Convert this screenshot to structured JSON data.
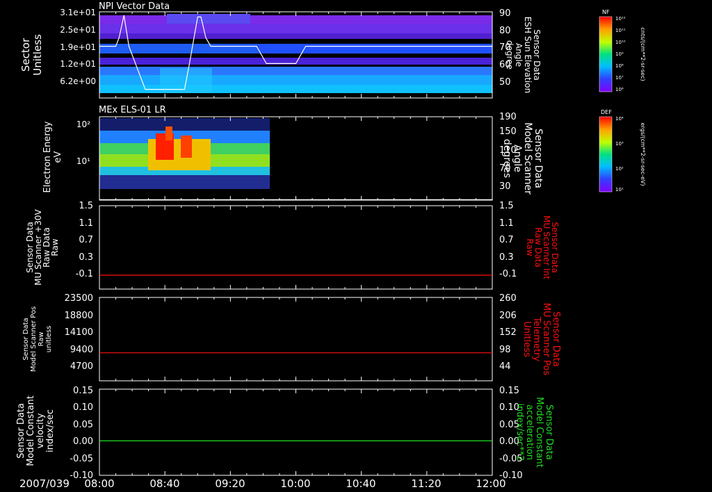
{
  "date_label": "2007/039",
  "x_ticks": [
    "08:00",
    "08:40",
    "09:20",
    "10:00",
    "10:40",
    "11:20",
    "12:00"
  ],
  "colors": {
    "white": "#ffffff",
    "red": "#ff1010",
    "green": "#22dd22",
    "panel_bg": "#000000"
  },
  "chart_data": [
    {
      "type": "heatmap",
      "title": "NPI Vector Data",
      "ylabel": [
        "Sector",
        "Unitless"
      ],
      "y_ticks": [
        "3.1e+01",
        "2.5e+01",
        "1.9e+01",
        "1.2e+01",
        "6.2e+00"
      ],
      "right_ylabel": [
        "Sensor Data",
        "ESH Sun Elevation",
        "Angle",
        "degree"
      ],
      "right_ticks": [
        "90",
        "80",
        "70",
        "60",
        "50"
      ],
      "right_range": [
        40,
        90
      ],
      "overlay_line": {
        "color": "white",
        "x": [
          "08:00",
          "08:05",
          "08:10",
          "08:12",
          "08:15",
          "08:18",
          "08:28",
          "08:52",
          "08:55",
          "09:00",
          "09:02",
          "09:05",
          "09:08",
          "09:25",
          "09:36",
          "09:42",
          "10:00",
          "10:06",
          "10:12",
          "12:00"
        ],
        "y": [
          70,
          70,
          70,
          75,
          88,
          70,
          45,
          45,
          60,
          87,
          87,
          75,
          70,
          70,
          70,
          60,
          60,
          70,
          70,
          70
        ]
      },
      "colorbar": {
        "label": "NF",
        "unit": "cnts/(cm**2-sr-sec)",
        "ticks": [
          "10¹²",
          "10¹¹",
          "10¹⁰",
          "10⁹",
          "10⁸",
          "10⁷",
          "10⁶"
        ]
      }
    },
    {
      "type": "heatmap",
      "title": "MEx ELS-01 LR",
      "ylabel": [
        "Electron Energy",
        "eV"
      ],
      "y_ticks": [
        "10²",
        "10¹"
      ],
      "right_ylabel": [
        "Sensor Data",
        "Model Scanner",
        "Angle",
        "degrees"
      ],
      "right_ticks": [
        "190",
        "150",
        "110",
        "70",
        "30"
      ],
      "right_range": [
        10,
        190
      ],
      "overlay_line": {
        "color": "white",
        "x": [
          "08:00",
          "12:00"
        ],
        "y": [
          11,
          11
        ]
      },
      "data_extent": [
        "08:00",
        "09:27"
      ],
      "colorbar": {
        "label": "DEF",
        "unit": "ergs/(cm**2-sr-sec-eV)",
        "ticks": [
          "10⁴",
          "10³",
          "10²",
          "10¹"
        ]
      }
    },
    {
      "type": "line",
      "ylabel": [
        "Sensor Data",
        "MU Scanner +30V",
        "Raw Data",
        "Raw"
      ],
      "y_ticks": [
        "1.5",
        "1.1",
        "0.7",
        "0.3",
        "-0.1"
      ],
      "ylim": [
        -0.3,
        1.5
      ],
      "right_ylabel": [
        "Sensor Data",
        "MU Scanner Int",
        "Raw Data",
        "Raw"
      ],
      "right_ticks": [
        "1.5",
        "1.1",
        "0.7",
        "0.3",
        "-0.1"
      ],
      "series": [
        {
          "color": "red",
          "x": [
            "08:00",
            "12:00"
          ],
          "y": [
            0.0,
            0.0
          ]
        }
      ]
    },
    {
      "type": "line",
      "ylabel": [
        "Sensor Data",
        "Model Scanner Pos",
        "Raw",
        "unitless"
      ],
      "y_ticks": [
        "23500",
        "18800",
        "14100",
        "9400",
        "4700"
      ],
      "ylim": [
        0,
        23500
      ],
      "right_ylabel": [
        "Sensor Data",
        "MU Scanner Pos",
        "Telemetry",
        "Unitless"
      ],
      "right_ticks": [
        "260",
        "206",
        "152",
        "98",
        "44"
      ],
      "series": [
        {
          "color": "red",
          "x": [
            "08:00",
            "12:00"
          ],
          "y": [
            7900,
            7900
          ]
        }
      ]
    },
    {
      "type": "line",
      "ylabel": [
        "Sensor Data",
        "Model Constant",
        "velocity",
        "index/sec"
      ],
      "y_ticks": [
        "0.15",
        "0.10",
        "0.05",
        "0.00",
        "-0.05",
        "-0.10"
      ],
      "ylim": [
        -0.1,
        0.15
      ],
      "right_ylabel": [
        "Sensor Data",
        "Model Constant",
        "acceleration",
        "index/sec**2"
      ],
      "right_ticks": [
        "0.15",
        "0.10",
        "0.05",
        "0.00",
        "-0.05",
        "-0.10"
      ],
      "series": [
        {
          "color": "green",
          "x": [
            "08:00",
            "12:00"
          ],
          "y": [
            0.0,
            0.0
          ]
        }
      ]
    }
  ]
}
